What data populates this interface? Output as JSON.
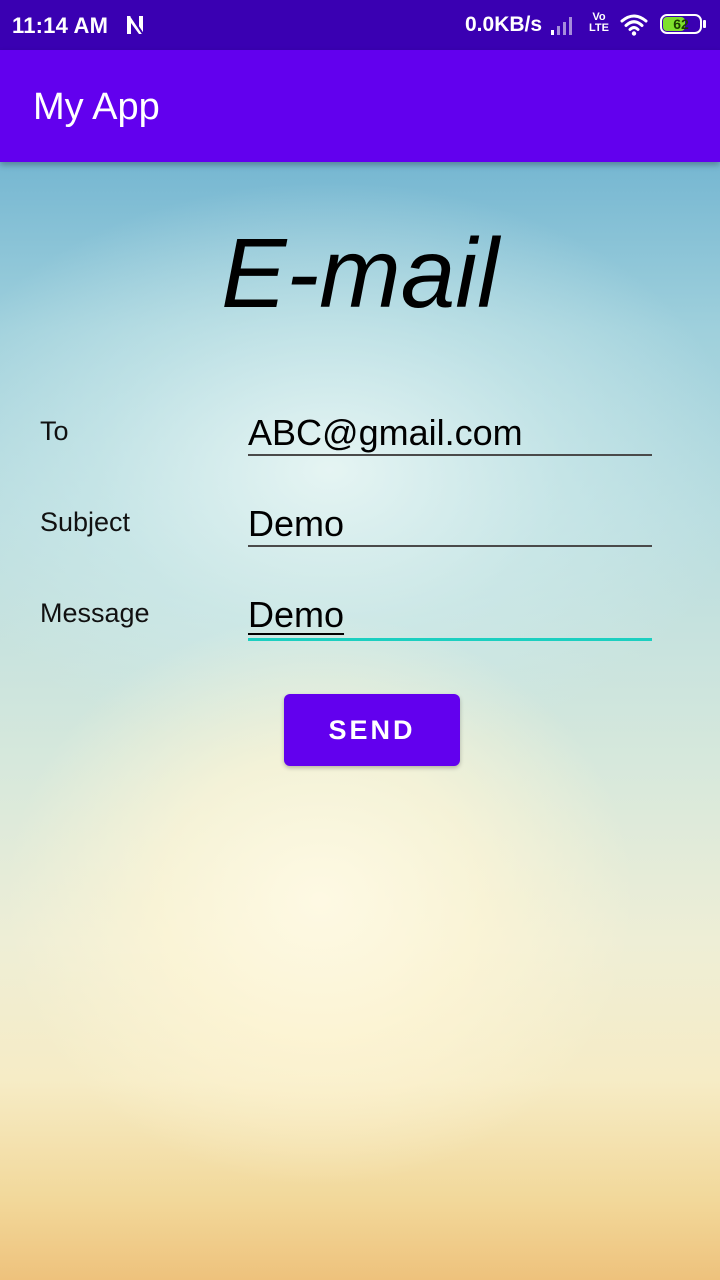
{
  "status_bar": {
    "time": "11:14 AM",
    "network_speed": "0.0KB/s",
    "volte_top": "Vo",
    "volte_bottom": "LTE",
    "battery_level": "62",
    "battery_fraction": 0.62,
    "icons": [
      "notification-n-icon",
      "signal-icon",
      "volte-icon",
      "wifi-icon",
      "battery-icon"
    ],
    "colors": {
      "background": "#3a00b2",
      "battery_fill": "#7ee02b"
    }
  },
  "app_bar": {
    "title": "My App",
    "color": "#6200ee"
  },
  "main": {
    "heading": "E-mail",
    "fields": {
      "to": {
        "label": "To",
        "value": "ABC@gmail.com"
      },
      "subject": {
        "label": "Subject",
        "value": "Demo"
      },
      "message": {
        "label": "Message",
        "value": "Demo",
        "focused": true
      }
    },
    "send_label": "SEND",
    "focus_color": "#1ccfc0"
  }
}
